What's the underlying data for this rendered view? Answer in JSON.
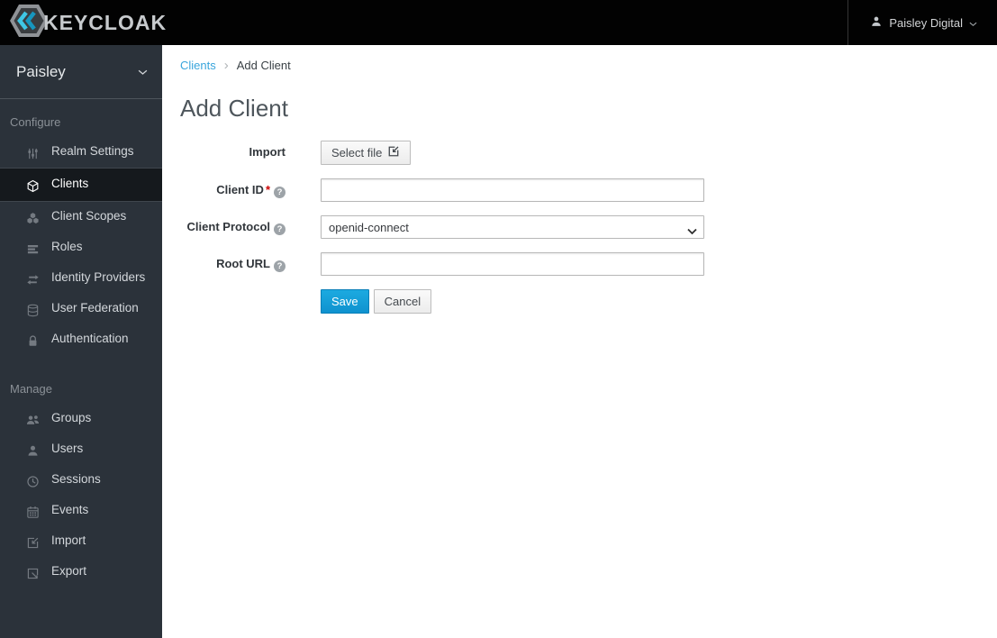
{
  "topbar": {
    "brand": "KEYCLOAK",
    "user_menu": {
      "name": "Paisley Digital",
      "icon": "user-icon",
      "chevron_icon": "chevron-down-icon"
    }
  },
  "sidebar": {
    "realm_selector": {
      "name": "Paisley",
      "chevron_icon": "chevron-down-icon"
    },
    "sections": [
      {
        "label": "Configure",
        "items": [
          {
            "label": "Realm Settings",
            "icon": "sliders-icon",
            "active": false
          },
          {
            "label": "Clients",
            "icon": "cube-icon",
            "active": true
          },
          {
            "label": "Client Scopes",
            "icon": "cubes-icon",
            "active": false
          },
          {
            "label": "Roles",
            "icon": "list-icon",
            "active": false
          },
          {
            "label": "Identity Providers",
            "icon": "exchange-arrows-icon",
            "active": false
          },
          {
            "label": "User Federation",
            "icon": "database-icon",
            "active": false
          },
          {
            "label": "Authentication",
            "icon": "lock-icon",
            "active": false
          }
        ]
      },
      {
        "label": "Manage",
        "items": [
          {
            "label": "Groups",
            "icon": "group-icon",
            "active": false
          },
          {
            "label": "Users",
            "icon": "user-icon",
            "active": false
          },
          {
            "label": "Sessions",
            "icon": "clock-icon",
            "active": false
          },
          {
            "label": "Events",
            "icon": "calendar-icon",
            "active": false
          },
          {
            "label": "Import",
            "icon": "import-icon",
            "active": false
          },
          {
            "label": "Export",
            "icon": "export-icon",
            "active": false
          }
        ]
      }
    ]
  },
  "breadcrumb": {
    "separator": "›",
    "items": [
      {
        "label": "Clients",
        "link": true
      },
      {
        "label": "Add Client",
        "link": false
      }
    ]
  },
  "main": {
    "title": "Add Client",
    "form": {
      "required_marker": "*",
      "fields": [
        {
          "label": "Import",
          "control": "button",
          "button_label": "Select file",
          "button_icon": "import-icon"
        },
        {
          "label": "Client ID",
          "required": true,
          "help": true,
          "control": "text",
          "value": ""
        },
        {
          "label": "Client Protocol",
          "help": true,
          "control": "select",
          "value": "openid-connect"
        },
        {
          "label": "Root URL",
          "help": true,
          "control": "text",
          "value": ""
        }
      ],
      "actions": {
        "save": "Save",
        "cancel": "Cancel"
      }
    }
  },
  "colors": {
    "accent_blue": "#0f92cf",
    "link_blue": "#39a5dc",
    "topbar_bg": "#020202",
    "sidebar_bg": "#2b323a",
    "active_item_bg": "#15191d",
    "required_red": "#cc0000"
  }
}
